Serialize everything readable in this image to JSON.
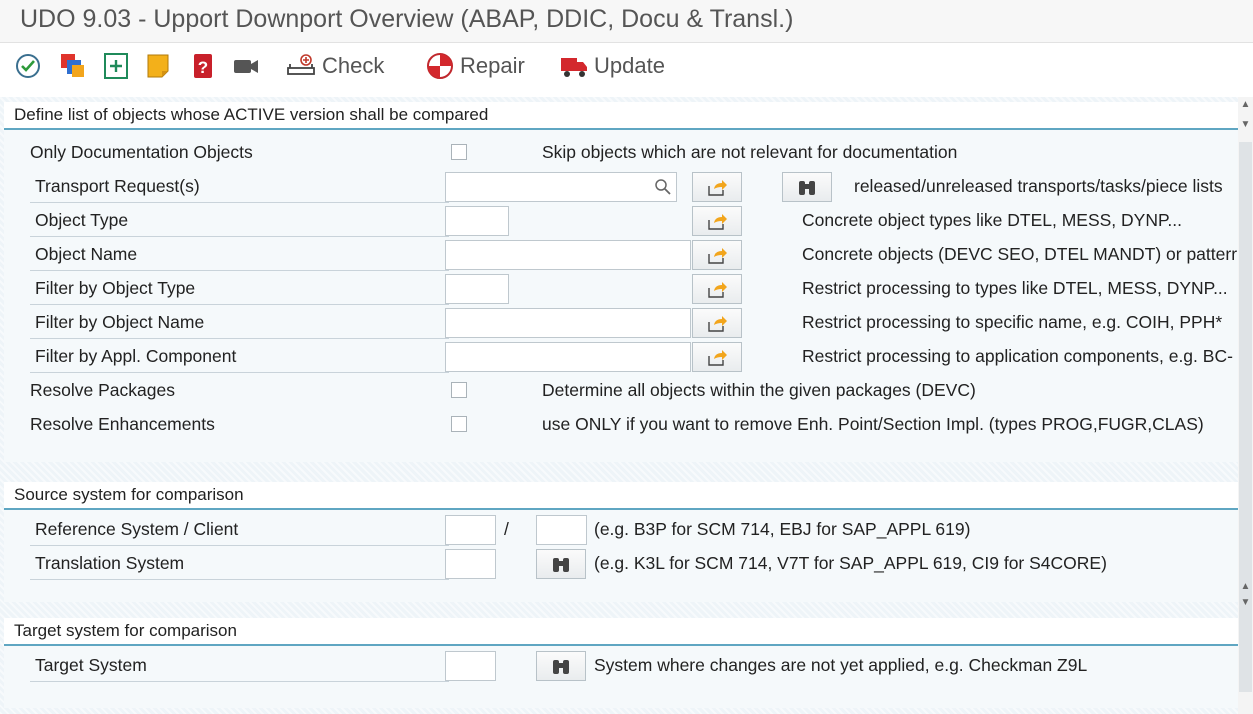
{
  "window": {
    "title": "UDO 9.03 - Upport Downport Overview (ABAP, DDIC, Docu & Transl.)"
  },
  "toolbar": {
    "check_label": "Check",
    "repair_label": "Repair",
    "update_label": "Update"
  },
  "group1": {
    "title": "Define list of objects whose ACTIVE version shall be compared",
    "only_doc_label": "Only Documentation Objects",
    "only_doc_desc": "Skip objects which are not relevant for documentation",
    "transport_label": "Transport Request(s)",
    "transport_desc": "released/unreleased transports/tasks/piece lists",
    "obj_type_label": "Object Type",
    "obj_type_desc": "Concrete object types like DTEL, MESS, DYNP...",
    "obj_name_label": "Object Name",
    "obj_name_desc": "Concrete objects (DEVC SEO, DTEL MANDT) or patterr",
    "filter_type_label": "Filter by Object Type",
    "filter_type_desc": "Restrict processing to types like DTEL, MESS, DYNP...",
    "filter_name_label": "Filter by Object Name",
    "filter_name_desc": "Restrict processing to specific name, e.g. COIH, PPH*",
    "filter_appl_label": "Filter by Appl. Component",
    "filter_appl_desc": "Restrict processing to application components, e.g. BC-",
    "resolve_pkg_label": "Resolve Packages",
    "resolve_pkg_desc": "Determine all objects within the given packages (DEVC)",
    "resolve_enh_label": "Resolve Enhancements",
    "resolve_enh_desc": "use ONLY if you want to remove Enh. Point/Section Impl. (types PROG,FUGR,CLAS)"
  },
  "group2": {
    "title": "Source system for comparison",
    "ref_label": "Reference System / Client",
    "ref_sep": "/",
    "ref_desc": "(e.g. B3P for SCM 714, EBJ for SAP_APPL 619)",
    "trans_label": "Translation System",
    "trans_desc": "(e.g. K3L for SCM 714, V7T for SAP_APPL 619, CI9 for S4CORE)"
  },
  "group3": {
    "title": "Target system for comparison",
    "target_label": "Target System",
    "target_desc": "System where changes are not yet applied, e.g. Checkman Z9L"
  },
  "colors": {
    "accent_line": "#5fa6c2",
    "field_border": "#bfc8ce"
  }
}
